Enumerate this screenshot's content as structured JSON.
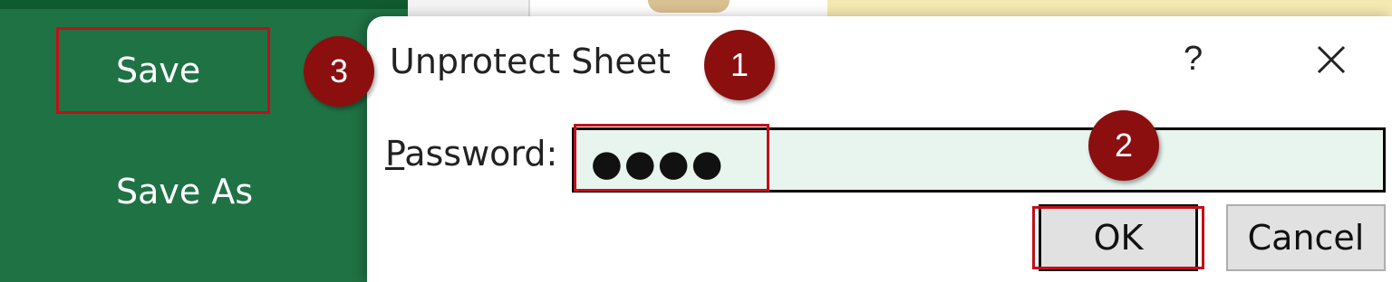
{
  "backstage": {
    "items": [
      {
        "label": "Save"
      },
      {
        "label": "Save As"
      }
    ]
  },
  "dialog": {
    "title": "Unprotect Sheet",
    "help_label": "?",
    "close_icon": "close-icon",
    "password_label_accesskey": "P",
    "password_label_rest": "assword:",
    "password_value": "●●●●",
    "ok_label": "OK",
    "cancel_label": "Cancel"
  },
  "annotations": {
    "step1": "1",
    "step2": "2",
    "step3": "3",
    "highlight_color": "#c0101a",
    "marker_color": "#8b0f0f"
  },
  "colors": {
    "backstage_green": "#1f7244",
    "input_fill": "#e8f4ee"
  }
}
